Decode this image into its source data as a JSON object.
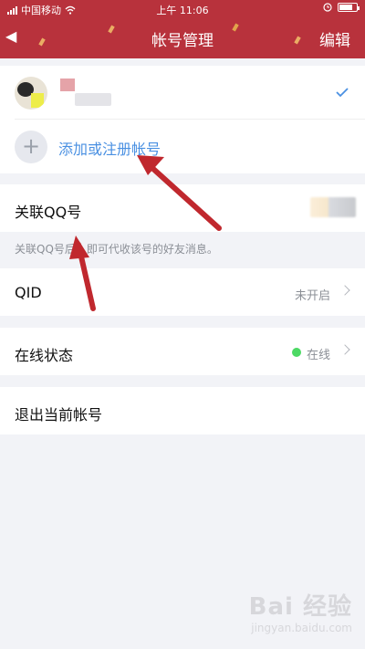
{
  "status_bar": {
    "carrier": "中国移动",
    "time": "上午 11:06"
  },
  "nav": {
    "back_icon": "back-arrow-icon",
    "title": "帐号管理",
    "edit_label": "编辑"
  },
  "account": {
    "add_label": "添加或注册帐号"
  },
  "linked_qq": {
    "label": "关联QQ号",
    "hint": "关联QQ号后，即可代收该号的好友消息。"
  },
  "qid": {
    "label": "QID",
    "value": "未开启"
  },
  "online_status": {
    "label": "在线状态",
    "value": "在线",
    "dot_color": "#4cd964"
  },
  "logout": {
    "label": "退出当前帐号"
  },
  "watermark": {
    "main": "Bai 经验",
    "sub": "jingyan.baidu.com"
  },
  "colors": {
    "nav_bg": "#b8323c",
    "accent": "#4a90e2",
    "arrow": "#c0282e"
  }
}
